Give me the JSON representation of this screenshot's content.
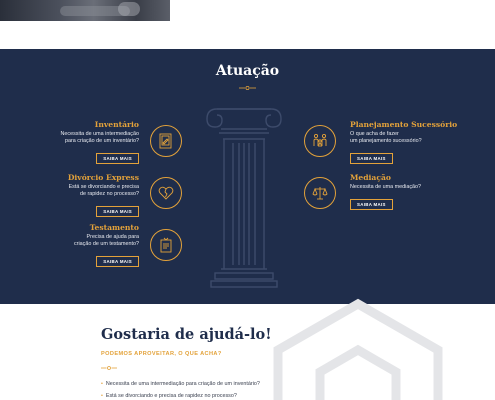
{
  "atuacao": {
    "title": "Atuação"
  },
  "services": {
    "inventario": {
      "title": "Inventário",
      "desc1": "Necessita de uma intermediação",
      "desc2": "para criação de um inventário?",
      "button": "SAIBA MAIS",
      "icon": "document-signature-icon"
    },
    "divorcio": {
      "title": "Divórcio Express",
      "desc1": "Está se divorciando e precisa",
      "desc2": "de rapidez no processo?",
      "button": "SAIBA MAIS",
      "icon": "broken-heart-icon"
    },
    "testamento": {
      "title": "Testamento",
      "desc1": "Precisa de ajuda para",
      "desc2": "criação de um testamento?",
      "button": "SAIBA MAIS",
      "icon": "will-document-icon"
    },
    "planejamento": {
      "title": "Planejamento Sucessório",
      "desc1": "O que acha de fazer",
      "desc2": "um planejamento sucessório?",
      "button": "SAIBA MAIS",
      "icon": "family-icon"
    },
    "mediacao": {
      "title": "Mediação",
      "desc1": "Necessita de uma mediação?",
      "button": "SAIBA MAIS",
      "icon": "scales-icon"
    }
  },
  "help": {
    "title": "Gostaria de ajudá-lo!",
    "subtitle": "PODEMOS APROVEITAR, O QUE ACHA?",
    "items": [
      "Necessita de uma intermediação para criação de um inventário?",
      "Está se divorciando e precisa de rapidez no processo?"
    ]
  },
  "colors": {
    "navy": "#1f2d4b",
    "gold": "#e3a23a"
  }
}
